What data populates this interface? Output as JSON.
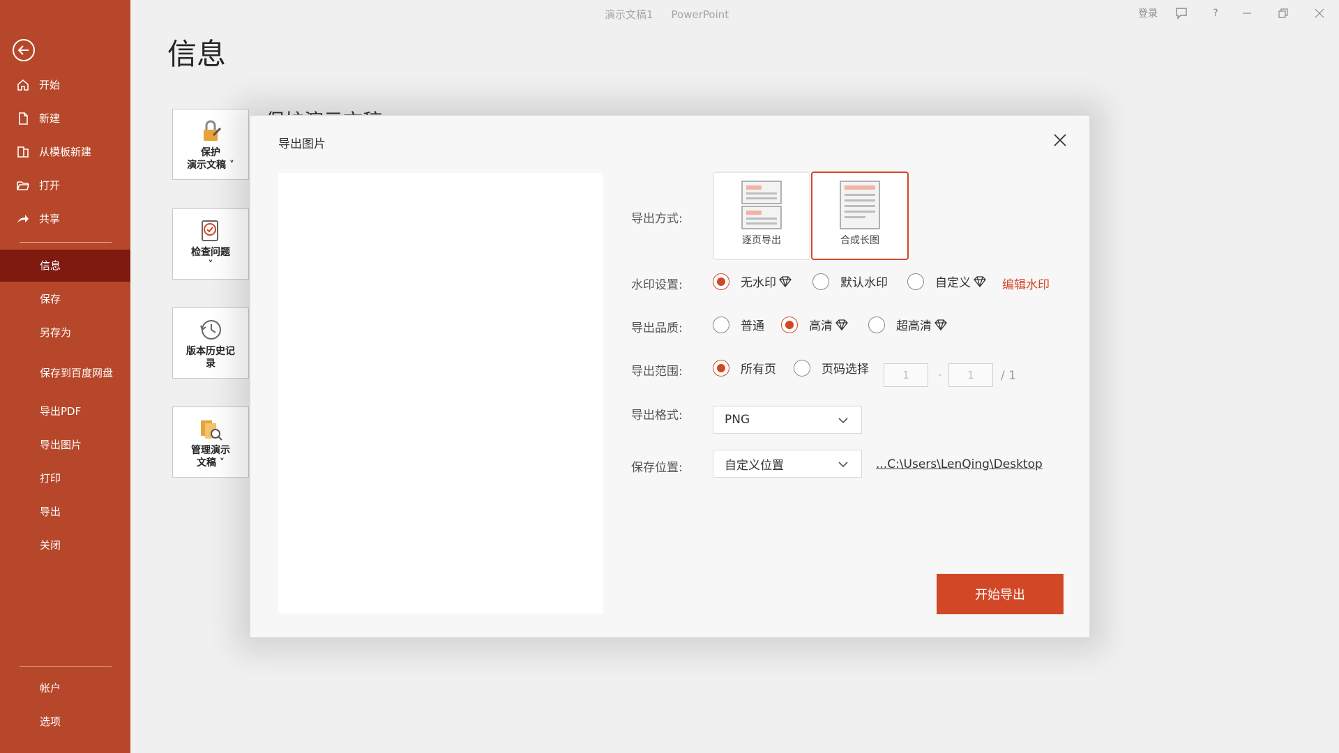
{
  "window": {
    "doc_name": "演示文稿1",
    "app_name": "PowerPoint",
    "login_label": "登录"
  },
  "sidebar": {
    "items": [
      {
        "label": "开始",
        "icon": "home-icon"
      },
      {
        "label": "新建",
        "icon": "new-file-icon"
      },
      {
        "label": "从模板新建",
        "icon": "template-icon"
      },
      {
        "label": "打开",
        "icon": "folder-open-icon"
      },
      {
        "label": "共享",
        "icon": "share-icon"
      },
      {
        "label": "信息"
      },
      {
        "label": "保存"
      },
      {
        "label": "另存为"
      },
      {
        "label": "保存到百度网盘"
      },
      {
        "label": "导出PDF"
      },
      {
        "label": "导出图片"
      },
      {
        "label": "打印"
      },
      {
        "label": "导出"
      },
      {
        "label": "关闭"
      },
      {
        "label": "帐户"
      },
      {
        "label": "选项"
      }
    ],
    "active": "信息"
  },
  "page": {
    "title": "信息",
    "cards": [
      {
        "line1": "保护",
        "line2": "演示文稿 ˅"
      },
      {
        "line1": "检查问题",
        "line2": "˅"
      },
      {
        "line1": "版本历史记",
        "line2": "录"
      },
      {
        "line1": "管理演示",
        "line2": "文稿 ˅"
      }
    ],
    "partial_heading": "保护演示文稿"
  },
  "dialog": {
    "title": "导出图片",
    "export_mode": {
      "label": "导出方式:",
      "options": [
        "逐页导出",
        "合成长图"
      ],
      "selected": "合成长图"
    },
    "watermark": {
      "label": "水印设置:",
      "options": [
        "无水印",
        "默认水印",
        "自定义"
      ],
      "selected": "无水印",
      "edit_link": "编辑水印"
    },
    "quality": {
      "label": "导出品质:",
      "options": [
        "普通",
        "高清",
        "超高清"
      ],
      "selected": "高清"
    },
    "range": {
      "label": "导出范围:",
      "options": [
        "所有页",
        "页码选择"
      ],
      "selected": "所有页",
      "from": "1",
      "to": "1",
      "separator": "-",
      "total": "/ 1"
    },
    "format": {
      "label": "导出格式:",
      "value": "PNG"
    },
    "location": {
      "label": "保存位置:",
      "value": "自定义位置",
      "path": "...C:\\Users\\LenQing\\Desktop"
    },
    "export_button": "开始导出"
  },
  "colors": {
    "brand": "#b7472a",
    "sidebar_active": "#7e1a0f",
    "accent": "#d24726"
  }
}
